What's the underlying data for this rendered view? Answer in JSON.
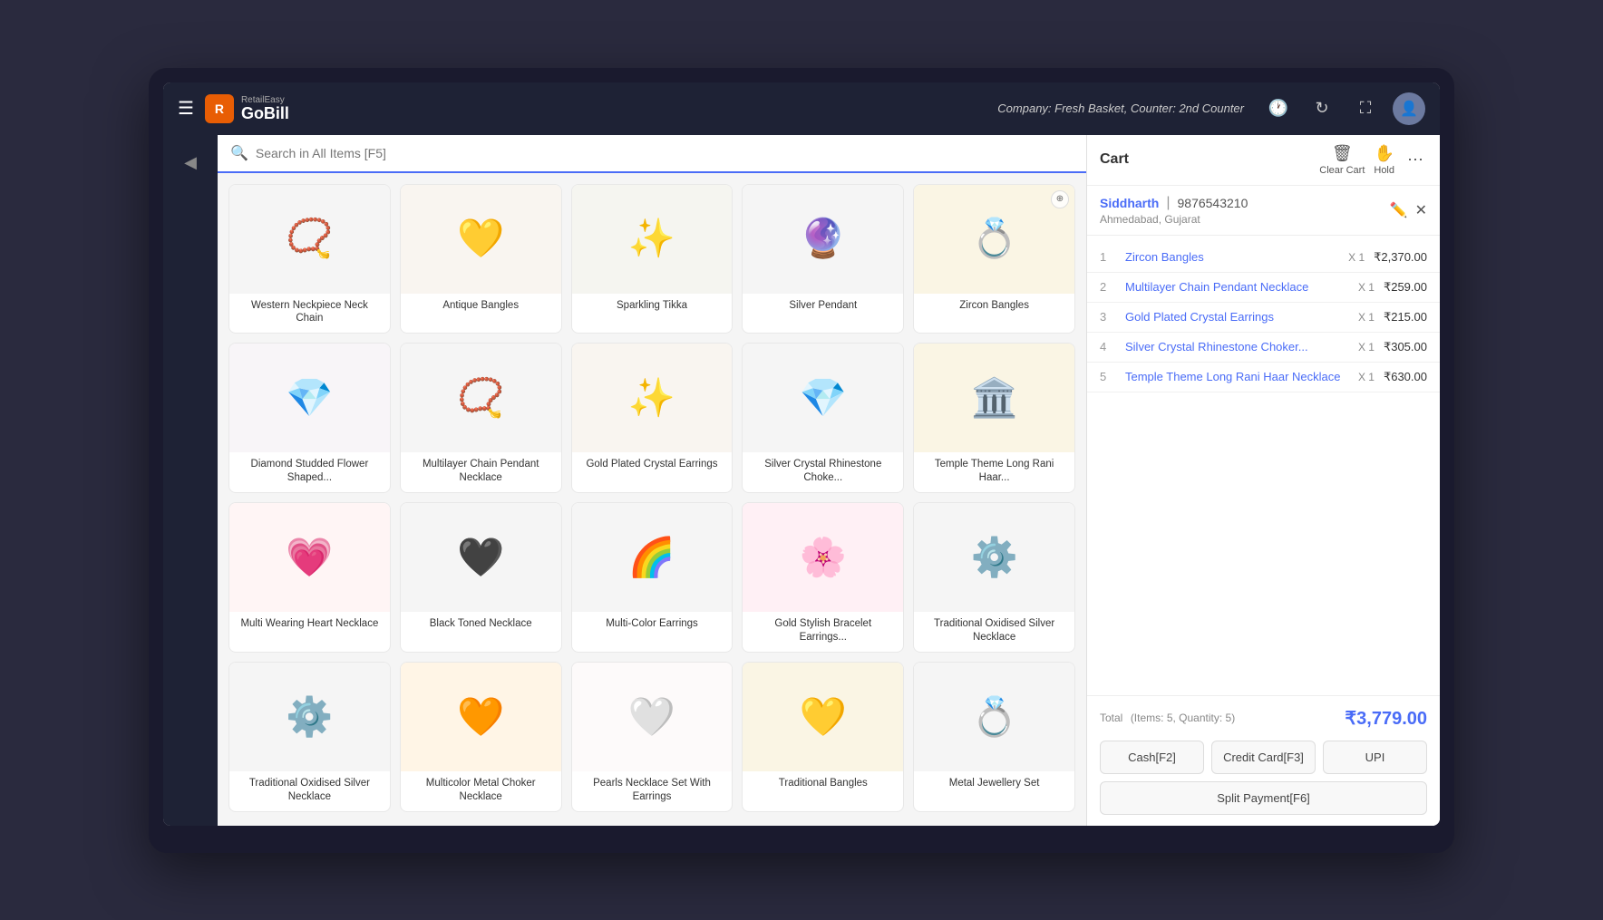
{
  "app": {
    "name": "GoBill",
    "brand": "RetailEasy",
    "company": "Company: Fresh Basket,  Counter: 2nd Counter"
  },
  "search": {
    "placeholder": "Search in All Items [F5]"
  },
  "products": [
    {
      "id": 1,
      "name": "Western Neckpiece Neck Chain",
      "emoji": "📿",
      "bg": "#f5f5f5"
    },
    {
      "id": 2,
      "name": "Antique Bangles",
      "emoji": "💛",
      "bg": "#f9f5f0"
    },
    {
      "id": 3,
      "name": "Sparkling Tikka",
      "emoji": "✨",
      "bg": "#f5f5f0"
    },
    {
      "id": 4,
      "name": "Silver Pendant",
      "emoji": "🔮",
      "bg": "#f5f5f5"
    },
    {
      "id": 5,
      "name": "Zircon Bangles",
      "emoji": "💍",
      "bg": "#faf5e4",
      "badge": "⊕"
    },
    {
      "id": 6,
      "name": "Diamond Studded Flower Shaped...",
      "emoji": "💎",
      "bg": "#f8f5f8"
    },
    {
      "id": 7,
      "name": "Multilayer Chain Pendant Necklace",
      "emoji": "📿",
      "bg": "#f5f5f5"
    },
    {
      "id": 8,
      "name": "Gold Plated Crystal Earrings",
      "emoji": "✨",
      "bg": "#f9f5f0"
    },
    {
      "id": 9,
      "name": "Silver Crystal Rhinestone Choke...",
      "emoji": "💎",
      "bg": "#f5f5f5"
    },
    {
      "id": 10,
      "name": "Temple Theme Long Rani Haar...",
      "emoji": "🏛️",
      "bg": "#faf5e4"
    },
    {
      "id": 11,
      "name": "Multi Wearing Heart Necklace",
      "emoji": "💗",
      "bg": "#fff5f5"
    },
    {
      "id": 12,
      "name": "Black Toned Necklace",
      "emoji": "🖤",
      "bg": "#f5f5f5"
    },
    {
      "id": 13,
      "name": "Multi-Color Earrings",
      "emoji": "🌈",
      "bg": "#f5f5f5"
    },
    {
      "id": 14,
      "name": "Gold Stylish Bracelet Earrings...",
      "emoji": "🌸",
      "bg": "#fff0f5"
    },
    {
      "id": 15,
      "name": "Traditional Oxidised Silver Necklace",
      "emoji": "⚙️",
      "bg": "#f5f5f5"
    },
    {
      "id": 16,
      "name": "Traditional Oxidised Silver Necklace",
      "emoji": "⚙️",
      "bg": "#f5f5f5"
    },
    {
      "id": 17,
      "name": "Multicolor Metal Choker Necklace",
      "emoji": "🧡",
      "bg": "#fff5e6"
    },
    {
      "id": 18,
      "name": "Pearls Necklace Set With Earrings",
      "emoji": "🤍",
      "bg": "#fdfafa"
    },
    {
      "id": 19,
      "name": "Traditional Bangles",
      "emoji": "💛",
      "bg": "#faf5e4"
    },
    {
      "id": 20,
      "name": "Metal Jewellery Set",
      "emoji": "💍",
      "bg": "#f5f5f5"
    }
  ],
  "cart": {
    "title": "Cart",
    "clear_label": "Clear Cart",
    "hold_label": "Hold",
    "customer": {
      "name": "Siddharth",
      "phone": "9876543210",
      "address": "Ahmedabad, Gujarat"
    },
    "items": [
      {
        "num": 1,
        "name": "Zircon Bangles",
        "qty": 1,
        "price": "₹2,370.00"
      },
      {
        "num": 2,
        "name": "Multilayer Chain Pendant Necklace",
        "qty": 1,
        "price": "₹259.00"
      },
      {
        "num": 3,
        "name": "Gold Plated Crystal Earrings",
        "qty": 1,
        "price": "₹215.00"
      },
      {
        "num": 4,
        "name": "Silver Crystal Rhinestone Choker...",
        "qty": 1,
        "price": "₹305.00"
      },
      {
        "num": 5,
        "name": "Temple Theme Long Rani Haar Necklace",
        "qty": 1,
        "price": "₹630.00"
      }
    ],
    "total": {
      "label": "Total",
      "items_info": "(Items: 5, Quantity: 5)",
      "amount": "₹3,779.00"
    },
    "payment_buttons": [
      {
        "id": "cash",
        "label": "Cash[F2]"
      },
      {
        "id": "credit",
        "label": "Credit Card[F3]"
      },
      {
        "id": "upi",
        "label": "UPI"
      }
    ],
    "split_label": "Split Payment[F6]"
  }
}
